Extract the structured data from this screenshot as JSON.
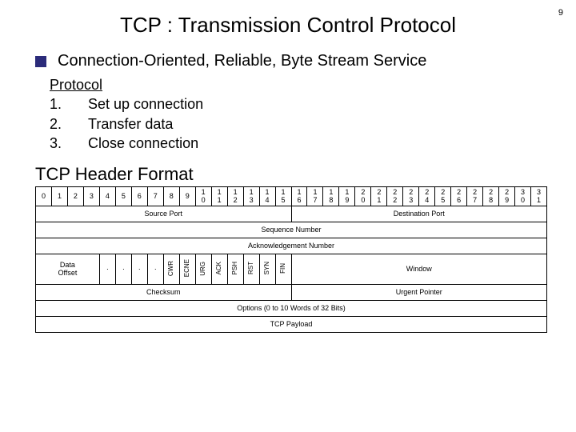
{
  "page_number": "9",
  "title": "TCP : Transmission Control Protocol",
  "bullet": "Connection-Oriented, Reliable, Byte Stream Service",
  "protocol": {
    "heading": "Protocol",
    "items": [
      {
        "n": "1.",
        "t": "Set up connection"
      },
      {
        "n": "2.",
        "t": "Transfer data"
      },
      {
        "n": "3.",
        "t": "Close connection"
      }
    ]
  },
  "subhead": "TCP Header Format",
  "bits": [
    "0",
    "1",
    "2",
    "3",
    "4",
    "5",
    "6",
    "7",
    "8",
    "9",
    "1\n0",
    "1\n1",
    "1\n2",
    "1\n3",
    "1\n4",
    "1\n5",
    "1\n6",
    "1\n7",
    "1\n8",
    "1\n9",
    "2\n0",
    "2\n1",
    "2\n2",
    "2\n3",
    "2\n4",
    "2\n5",
    "2\n6",
    "2\n7",
    "2\n8",
    "2\n9",
    "3\n0",
    "3\n1"
  ],
  "rows": {
    "source": "Source Port",
    "dest": "Destination Port",
    "seq": "Sequence Number",
    "ack": "Acknowledgement Number",
    "data_offset": "Data\nOffset",
    "flags": [
      "·",
      "·",
      "·",
      "·",
      "CWR",
      "ECNE",
      "URG",
      "ACK",
      "PSH",
      "RST",
      "SYN",
      "FIN"
    ],
    "window": "Window",
    "checksum": "Checksum",
    "urgent": "Urgent Pointer",
    "options": "Options (0 to 10 Words of 32 Bits)",
    "payload": "TCP Payload"
  }
}
